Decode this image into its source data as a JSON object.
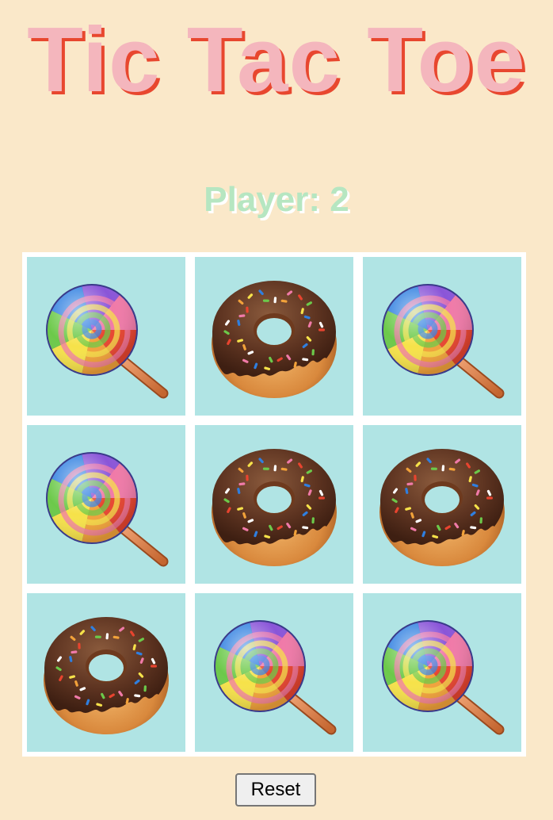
{
  "title": "Tic Tac Toe",
  "player_label": "Player: 2",
  "reset_label": "Reset",
  "colors": {
    "background": "#fae8c9",
    "title_fill": "#f4b6bd",
    "title_shadow": "#e8472f",
    "player_text": "#b6e6c1",
    "cell": "#b0e4e4",
    "grid_lines": "#ffffff"
  },
  "board": [
    [
      "lollipop",
      "donut",
      "lollipop"
    ],
    [
      "lollipop",
      "donut",
      "donut"
    ],
    [
      "donut",
      "lollipop",
      "lollipop"
    ]
  ]
}
